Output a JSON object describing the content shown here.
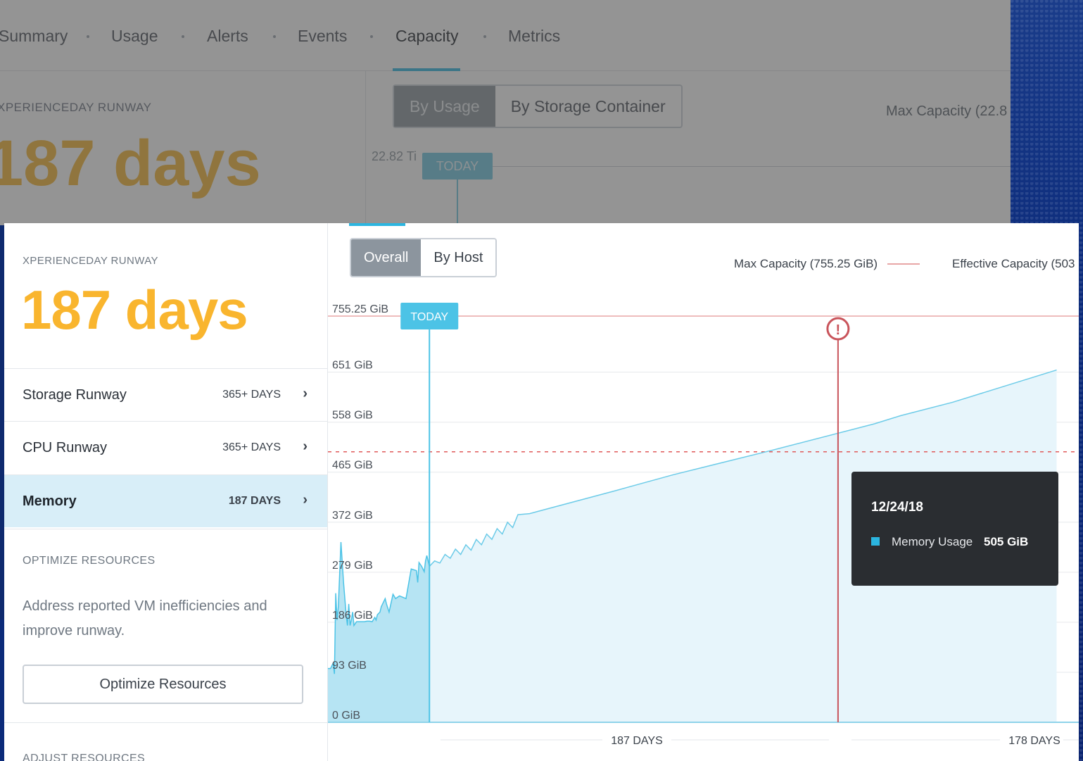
{
  "background_window": {
    "tabs": [
      "Summary",
      "Usage",
      "Alerts",
      "Events",
      "Capacity",
      "Metrics"
    ],
    "active_tab": "Capacity",
    "runway_title": "XPERIENCEDAY RUNWAY",
    "runway_days": "187 days",
    "segments": [
      "By Usage",
      "By Storage Container"
    ],
    "max_capacity": "Max Capacity (22.8",
    "axis_top": "22.82 Ti",
    "today": "TODAY"
  },
  "left_panel": {
    "title": "XPERIENCEDAY RUNWAY",
    "runway_days": "187 days",
    "items": [
      {
        "label": "Storage Runway",
        "value": "365+ DAYS",
        "selected": false
      },
      {
        "label": "CPU Runway",
        "value": "365+ DAYS",
        "selected": false
      },
      {
        "label": "Memory",
        "value": "187 DAYS",
        "selected": true
      }
    ],
    "optimize_title": "OPTIMIZE RESOURCES",
    "optimize_desc": "Address reported VM inefficiencies and improve runway.",
    "optimize_button": "Optimize Resources",
    "adjust_title": "ADJUST RESOURCES"
  },
  "chart_panel": {
    "segments": [
      {
        "label": "Overall",
        "active": true
      },
      {
        "label": "By Host",
        "active": false
      }
    ],
    "legend_max": "Max Capacity (755.25 GiB)",
    "legend_effective": "Effective Capacity (503",
    "today_label": "TODAY",
    "warning_glyph": "!",
    "tooltip": {
      "date": "12/24/18",
      "series": "Memory Usage",
      "value": "505 GiB"
    },
    "bottom_labels": [
      "187 DAYS",
      "178 DAYS"
    ],
    "colors": {
      "usage": "#2bb5e0",
      "max_capacity": "#e8a6a6",
      "effective_capacity": "#e05a5a",
      "warning": "#c9545b"
    }
  },
  "chart_data": {
    "type": "area",
    "y_ticks": [
      "0 GiB",
      "93 GiB",
      "186 GiB",
      "279 GiB",
      "372 GiB",
      "465 GiB",
      "558 GiB",
      "651 GiB",
      "755.25 GiB"
    ],
    "ylim": [
      0,
      755.25
    ],
    "max_capacity": 755.25,
    "effective_capacity": 503,
    "historical_x_days": [
      0,
      2,
      4,
      5,
      6,
      7,
      8,
      10,
      12,
      14,
      15,
      16,
      17,
      18,
      19,
      20,
      22,
      25,
      28,
      30,
      32,
      34,
      36,
      37,
      38,
      40,
      41,
      42,
      44,
      45,
      47,
      50,
      52,
      55,
      60,
      64,
      68,
      69,
      70,
      72,
      74,
      75,
      76,
      77,
      78
    ],
    "historical_values": [
      100,
      100,
      110,
      90,
      240,
      190,
      215,
      335,
      260,
      200,
      180,
      220,
      180,
      190,
      205,
      180,
      187,
      187,
      187,
      188,
      188,
      187,
      195,
      190,
      200,
      205,
      215,
      220,
      230,
      220,
      205,
      238,
      230,
      235,
      230,
      285,
      282,
      260,
      297,
      290,
      280,
      300,
      310,
      300,
      290
    ],
    "today_x_day": 78,
    "forecast_x_days": [
      78,
      82,
      86,
      90,
      94,
      98,
      102,
      106,
      110,
      114,
      118,
      122,
      126,
      130,
      134,
      138,
      142,
      146,
      155,
      220,
      265,
      340,
      420,
      440,
      480,
      560
    ],
    "forecast_values": [
      290,
      300,
      296,
      312,
      305,
      322,
      312,
      330,
      320,
      340,
      330,
      350,
      340,
      360,
      350,
      372,
      362,
      386,
      388,
      430,
      460,
      505,
      555,
      570,
      595,
      655
    ],
    "marker_x_day": 392,
    "xlim": [
      0,
      577
    ]
  }
}
